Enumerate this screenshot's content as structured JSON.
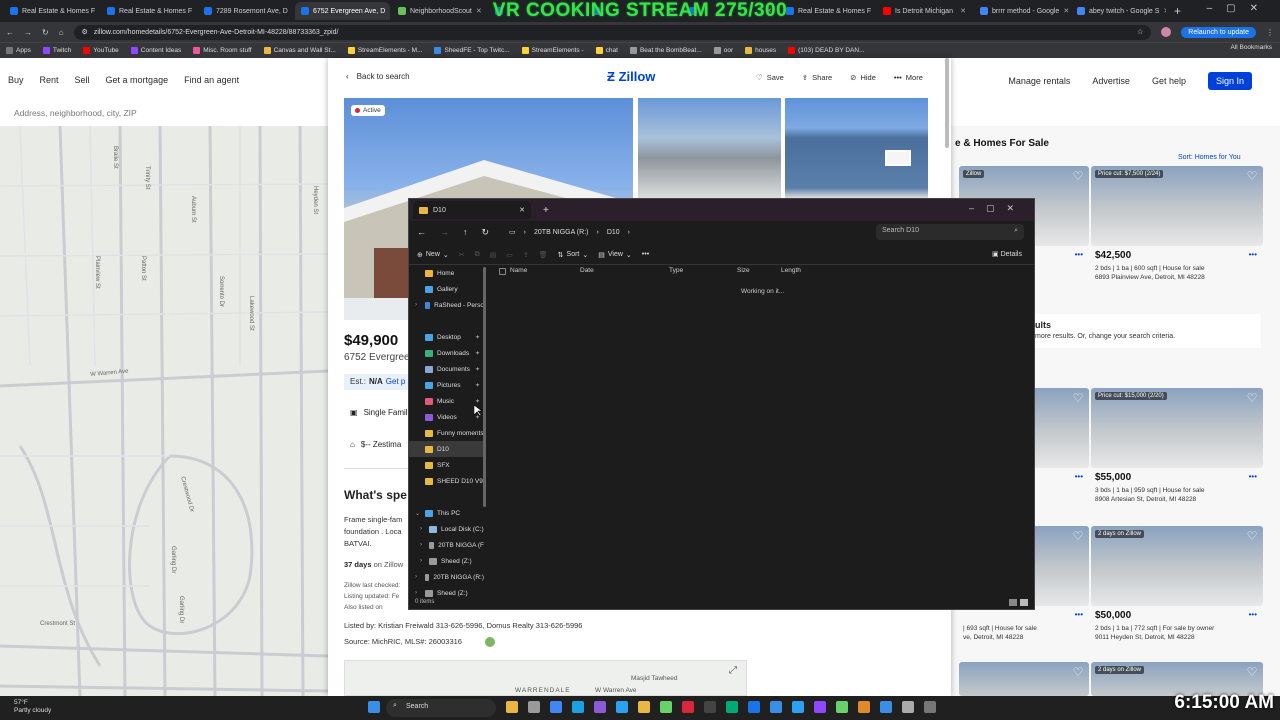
{
  "overlay_title": "VR COOKING STREAM 275/300",
  "browser": {
    "tabs": [
      {
        "label": "Real Estate & Homes F",
        "color": "#1a73e8"
      },
      {
        "label": "Real Estate & Homes F",
        "color": "#1a73e8"
      },
      {
        "label": "7289 Rosemont Ave, D",
        "color": "#1a73e8"
      },
      {
        "label": "6752 Evergreen Ave, D",
        "color": "#1a73e8",
        "active": true
      },
      {
        "label": "NeighborhoodScout",
        "color": "#6bbf59"
      },
      {
        "label": "",
        "color": "#1a73e8"
      },
      {
        "label": "",
        "color": "#1a73e8"
      },
      {
        "label": "",
        "color": "#1a73e8"
      },
      {
        "label": "Real Estate & Homes F",
        "color": "#1a73e8"
      },
      {
        "label": "Is Detroit Michigan",
        "color": "#ff0000"
      },
      {
        "label": "brrrr method - Google",
        "color": "#4285f4"
      },
      {
        "label": "abey twitch - Google S",
        "color": "#4285f4"
      }
    ],
    "url": "zillow.com/homedetails/6752-Evergreen-Ave-Detroit-MI-48228/88733363_zpid/",
    "relaunch": "Relaunch to update",
    "bookmarks": [
      "Apps",
      "Twitch",
      "YouTube",
      "Content Ideas",
      "Misc. Room stuff",
      "Canvas and Wall St...",
      "StreamElements - M...",
      "SheedFE - Top Twitc...",
      "StreamElements -",
      "chat",
      "Beat the BombBeat...",
      "oor",
      "houses",
      "(103) DEAD BY DAN..."
    ],
    "all_bookmarks": "All Bookmarks"
  },
  "zillow": {
    "nav_left": [
      "Buy",
      "Rent",
      "Sell",
      "Get a mortgage",
      "Find an agent"
    ],
    "nav_right": [
      "Manage rentals",
      "Advertise",
      "Get help"
    ],
    "sign_in": "Sign In",
    "search_placeholder": "Address, neighborhood, city, ZIP",
    "brand": "Zillow",
    "back": "Back to search",
    "actions": [
      "Save",
      "Share",
      "Hide",
      "More"
    ],
    "badge": "Active",
    "price": "$49,900",
    "address": "6752 Evergreen",
    "est_label": "Est.:",
    "est_value": "N/A",
    "est_link": "Get p",
    "facts": [
      "Single Famil",
      "$-- Zestima"
    ],
    "section_title": "What's spe",
    "desc": [
      "Frame single-fam",
      "foundation . Loca",
      "BATVAI."
    ],
    "days": "37 days",
    "days_suffix": "on Zillow",
    "last_checked": "Zillow last checked:",
    "listing_updated": "Listing updated: Fe",
    "also_listed": "Also listed on",
    "listed_by": "Listed by: Kristian Freiwald 313-626-5996, Domus Realty 313-626-5996",
    "source": "Source: MichRIC,  MLS#: 26003316",
    "map_label1": "Masjid Tawheed",
    "map_label2": "WARRENDALE",
    "map_label3": "W Warren Ave"
  },
  "listings": {
    "header": "e & Homes For Sale",
    "sort": "Sort: Homes for You",
    "no_results": "ults",
    "no_results_sub": "more results. Or, change your search criteria.",
    "cards": [
      {
        "badge": "Zillow",
        "price": "",
        "meta1": "",
        "meta2": ""
      },
      {
        "badge": "Price cut: $7,500 (2/24)",
        "price": "$42,500",
        "meta1": "2 bds | 1 ba | 600 sqft | House for sale",
        "meta2": "6893 Plainview Ave, Detroit, MI 48228"
      },
      {
        "badge": "",
        "price": "",
        "meta1": "",
        "meta2": ""
      },
      {
        "badge": "Price cut: $15,000 (2/20)",
        "price": "$55,000",
        "meta1": "3 bds | 1 ba | 959 sqft | House for sale",
        "meta2": "8908 Artesian St, Detroit, MI 48228"
      },
      {
        "badge": "2 days on Zillow",
        "price": "",
        "meta1": "| 693 sqft | House for sale",
        "meta2": "ve, Detroit, MI 48228"
      },
      {
        "badge": "2 days on Zillow",
        "price": "$50,000",
        "meta1": "2 bds | 1 ba | 772 sqft | For sale by owner",
        "meta2": "9011 Heyden St, Detroit, MI 48228"
      }
    ],
    "bottom_badge": "2 days on Zillow"
  },
  "map_streets": [
    "W Warren Ave",
    "Braile St",
    "Trinity St",
    "Patton St",
    "Auburn St",
    "Crestmont St",
    "Sorrento Dr",
    "Crestwood Dr",
    "Garling Dr",
    "Garling Dr",
    "Lakewood St",
    "Heyden St",
    "Plainview St"
  ],
  "explorer": {
    "tab_title": "D10",
    "breadcrumbs": [
      "20TB NIGGA (R:)",
      "D10"
    ],
    "search_placeholder": "Search D10",
    "toolbar": {
      "new": "New",
      "sort": "Sort",
      "view": "View",
      "details": "Details"
    },
    "columns": [
      "Name",
      "Date",
      "Type",
      "Size",
      "Length"
    ],
    "working": "Working on it...",
    "status": "0 items",
    "sidebar": [
      {
        "label": "Home",
        "icon": "home-icon",
        "color": "#f0b43c"
      },
      {
        "label": "Gallery",
        "icon": "gallery-icon",
        "color": "#4aa3e8"
      },
      {
        "label": "RaSheed - Perso",
        "icon": "cloud-icon",
        "color": "#3b8ad9",
        "expand": true
      },
      {
        "label": "",
        "spacer": true
      },
      {
        "label": "Desktop",
        "icon": "desktop-icon",
        "color": "#4aa3e8",
        "pin": true
      },
      {
        "label": "Downloads",
        "icon": "downloads-icon",
        "color": "#3ab07a",
        "pin": true
      },
      {
        "label": "Documents",
        "icon": "documents-icon",
        "color": "#8aa7d6",
        "pin": true
      },
      {
        "label": "Pictures",
        "icon": "pictures-icon",
        "color": "#4aa3e8",
        "pin": true
      },
      {
        "label": "Music",
        "icon": "music-icon",
        "color": "#e0587a",
        "pin": true
      },
      {
        "label": "Videos",
        "icon": "videos-icon",
        "color": "#8a5ad8",
        "pin": true
      },
      {
        "label": "Funny moments",
        "icon": "folder-icon",
        "color": "#e8b843"
      },
      {
        "label": "D10",
        "icon": "folder-icon",
        "color": "#e8b843",
        "selected": true
      },
      {
        "label": "SFX",
        "icon": "folder-icon",
        "color": "#e8b843"
      },
      {
        "label": "SHEED D10 V9",
        "icon": "folder-icon",
        "color": "#e8b843"
      },
      {
        "label": "",
        "spacer": true
      },
      {
        "label": "This PC",
        "icon": "pc-icon",
        "color": "#4aa3e8",
        "expand": true
      },
      {
        "label": "Local Disk (C:)",
        "icon": "drive-icon",
        "color": "#8fb8e0",
        "expand": true,
        "indent": true
      },
      {
        "label": "20TB NIGGA (F",
        "icon": "drive-icon",
        "color": "#9a9a9a",
        "expand": true,
        "indent": true
      },
      {
        "label": "Sheed (Z:)",
        "icon": "drive-icon",
        "color": "#9a9a9a",
        "expand": true,
        "indent": true
      },
      {
        "label": "20TB NIGGA (R:)",
        "icon": "drive-icon",
        "color": "#9a9a9a",
        "expand": true
      },
      {
        "label": "Sheed (Z:)",
        "icon": "drive-icon",
        "color": "#9a9a9a",
        "expand": true
      }
    ]
  },
  "taskbar": {
    "temp": "57°F",
    "weather": "Partly cloudy",
    "search": "Search",
    "clock": "6:15:00 AM"
  }
}
